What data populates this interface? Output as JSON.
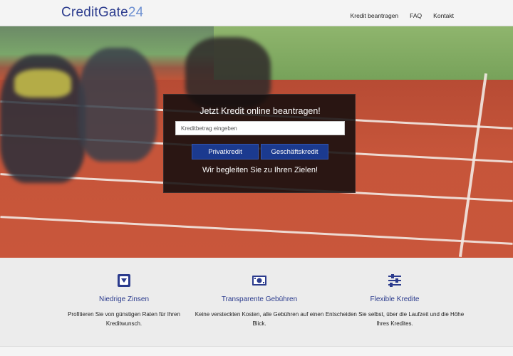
{
  "header": {
    "logo_main": "CreditGate",
    "logo_accent": "24",
    "nav": [
      "Kredit beantragen",
      "FAQ",
      "Kontakt"
    ]
  },
  "hero": {
    "title": "Jetzt Kredit online beantragen!",
    "input_placeholder": "Kreditbetrag eingeben",
    "buttons": [
      "Privatkredit",
      "Geschäftskredit"
    ],
    "subtitle": "Wir begleiten Sie zu Ihren Zielen!"
  },
  "features": [
    {
      "icon": "percent-down-icon",
      "title": "Niedrige Zinsen",
      "description": "Profitieren Sie von günstigen Raten für Ihren Kreditwunsch."
    },
    {
      "icon": "banknote-icon",
      "title": "Transparente Gebühren",
      "description": "Keine versteckten Kosten, alle Gebühren auf einen Blick."
    },
    {
      "icon": "sliders-icon",
      "title": "Flexible Kredite",
      "description": "Entscheiden Sie selbst, über die Laufzeit und die Höhe Ihres Kredites."
    }
  ],
  "colors": {
    "brand": "#2b3b8d",
    "brand_accent": "#6c8fd1",
    "button": "#1b3a8f",
    "overlay": "#140e0e"
  }
}
